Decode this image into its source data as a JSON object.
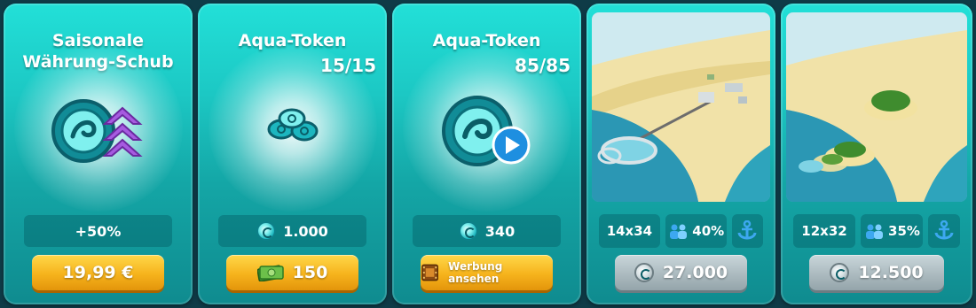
{
  "cards": [
    {
      "title": "Saisonale Währung-Schub",
      "info": "+50%",
      "button_label": "19,99 €"
    },
    {
      "title": "Aqua-Token",
      "counter": "15/15",
      "info": "1.000",
      "button_label": "150",
      "button_icon": "cash-icon"
    },
    {
      "title": "Aqua-Token",
      "counter": "85/85",
      "info": "340",
      "button_label": "Werbung ansehen",
      "button_icon": "film-icon"
    },
    {
      "size": "14x34",
      "population": "40%",
      "feature_icon": "anchor-icon",
      "button_label": "27.000"
    },
    {
      "size": "12x32",
      "population": "35%",
      "feature_icon": "anchor-icon",
      "button_label": "12.500"
    }
  ],
  "colors": {
    "card_accent": "#1cc8c4",
    "gold_button": "#f6b31c",
    "gray_button": "#a9b8bd",
    "play_blue": "#1e8fe0",
    "arrow_purple": "#9b4fd8"
  }
}
